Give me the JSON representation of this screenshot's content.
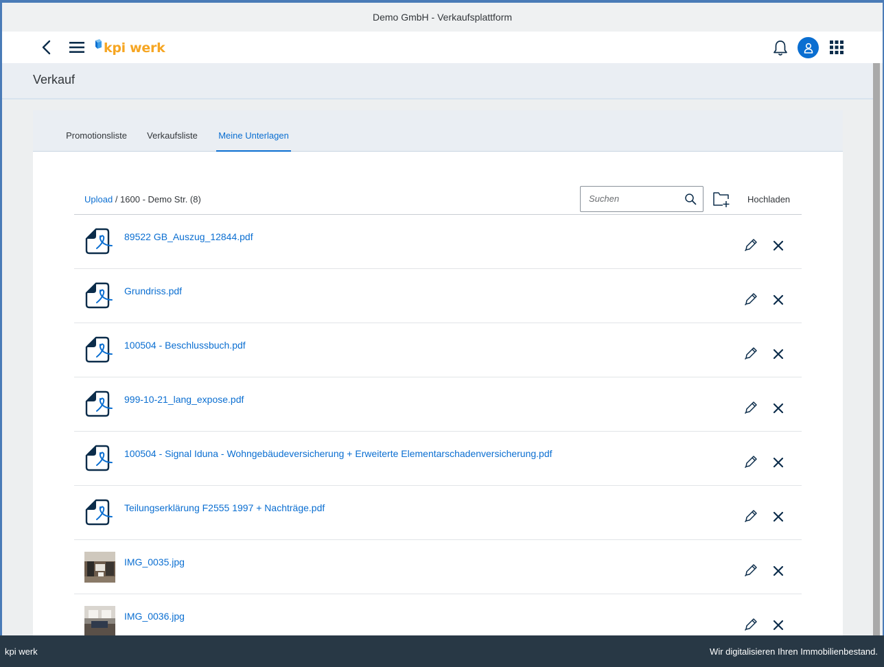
{
  "window": {
    "title": "Demo GmbH - Verkaufsplattform"
  },
  "shell": {
    "logo_text": "kpi werk",
    "avatar_color": "#0a6ed1",
    "brand_color": "#f6a623"
  },
  "page": {
    "title": "Verkauf"
  },
  "tabs": [
    {
      "label": "Promotionsliste"
    },
    {
      "label": "Verkaufsliste"
    },
    {
      "label": "Meine Unterlagen",
      "active": true
    }
  ],
  "breadcrumb": {
    "link": "Upload",
    "separator": " / ",
    "current": "1600 - Demo Str. (8)"
  },
  "search": {
    "placeholder": "Suchen",
    "value": ""
  },
  "toolbar": {
    "upload_label": "Hochladen"
  },
  "files": [
    {
      "name": "89522 GB_Auszug_12844.pdf",
      "icon": "pdf-file-icon"
    },
    {
      "name": "Grundriss.pdf",
      "icon": "pdf-file-icon"
    },
    {
      "name": "100504 - Beschlussbuch.pdf",
      "icon": "pdf-file-icon"
    },
    {
      "name": "999-10-21_lang_expose.pdf",
      "icon": "pdf-file-icon"
    },
    {
      "name": "100504 - Signal Iduna - Wohngebäudeversicherung + Erweiterte Elementarschadenversicherung.pdf",
      "icon": "pdf-file-icon"
    },
    {
      "name": "Teilungserklärung F2555 1997 + Nachträge.pdf",
      "icon": "pdf-file-icon"
    },
    {
      "name": "IMG_0035.jpg",
      "icon": "image-thumbnail"
    },
    {
      "name": "IMG_0036.jpg",
      "icon": "image-thumbnail"
    }
  ],
  "footer": {
    "left": "kpi werk",
    "right": "Wir digitalisieren Ihren Immobilienbestand."
  }
}
